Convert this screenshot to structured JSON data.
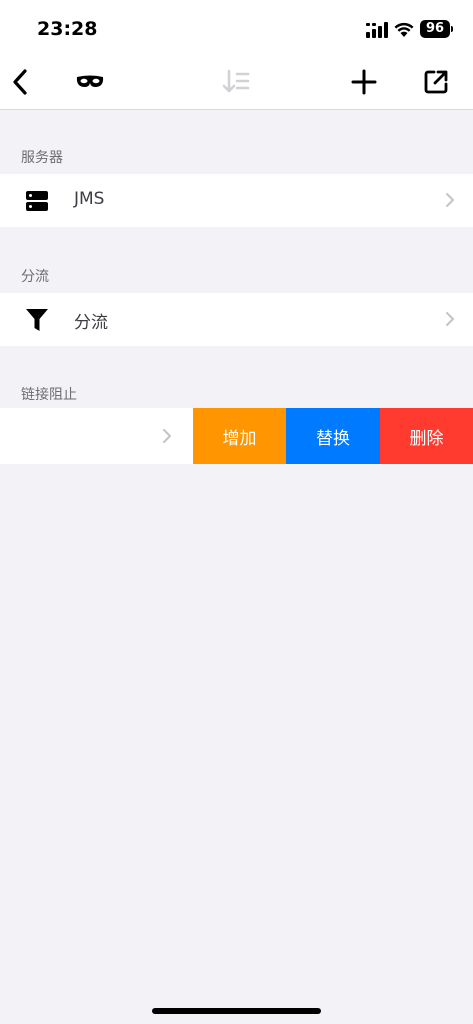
{
  "status_bar": {
    "time": "23:28",
    "battery": "96"
  },
  "nav": {
    "icons": [
      "back-icon",
      "incognito-mask-icon",
      "sort-icon",
      "add-icon",
      "share-icon"
    ]
  },
  "sections": [
    {
      "header": "服务器",
      "row_label": "JMS",
      "icon": "server-icon"
    },
    {
      "header": "分流",
      "row_label": "分流",
      "icon": "filter-funnel-icon"
    },
    {
      "header": "链接阻止",
      "row_label": ""
    }
  ],
  "swipe_actions": {
    "add_label": "增加",
    "replace_label": "替换",
    "delete_label": "删除",
    "colors": {
      "add": "#ff9500",
      "replace": "#007aff",
      "delete": "#ff3b30"
    }
  }
}
